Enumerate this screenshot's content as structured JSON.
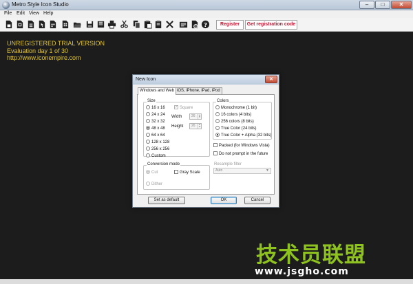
{
  "window": {
    "title": "Metro Style Icon Studio",
    "minimize": "–",
    "maximize": "□",
    "close": "✕"
  },
  "menu": {
    "items": [
      "File",
      "Edit",
      "View",
      "Help"
    ]
  },
  "toolbar": {
    "icons": [
      "new-icon",
      "new-from-image-icon",
      "new-from-file-icon",
      "cursor-icon",
      "template-icon",
      "layout-icon",
      "open-folder-icon",
      "save-icon",
      "save-as-icon",
      "print-icon",
      "cut-icon",
      "copy-icon",
      "paste-icon",
      "delete-icon",
      "import-icon",
      "export-icon",
      "help-icon"
    ],
    "register_label": "Register",
    "get_code_label": "Get registration code"
  },
  "trial": {
    "line1": "UNREGISTERED TRIAL VERSION",
    "line2": "Evaluation day 1 of 30",
    "line3": "http://www.iconempire.com"
  },
  "dialog": {
    "title": "New Icon",
    "close": "✕",
    "tabs": [
      {
        "label": "Windows and Web",
        "active": true
      },
      {
        "label": "iOS, iPhone, iPad, iPod",
        "active": false
      }
    ],
    "size": {
      "label": "Size",
      "options": [
        {
          "label": "16 x 16",
          "checked": false
        },
        {
          "label": "24 x 24",
          "checked": false
        },
        {
          "label": "32 x 32",
          "checked": false
        },
        {
          "label": "48 x 48",
          "checked": true
        },
        {
          "label": "64 x 64",
          "checked": false
        },
        {
          "label": "128 x 128",
          "checked": false
        },
        {
          "label": "256 x 256",
          "checked": false
        },
        {
          "label": "Custom",
          "checked": false
        }
      ],
      "square_label": "Square",
      "width_label": "Width",
      "width_value": "26",
      "height_label": "Height",
      "height_value": "26"
    },
    "colors": {
      "label": "Colors",
      "options": [
        {
          "label": "Monochrome (1 bit)",
          "checked": false
        },
        {
          "label": "16 colors (4 bits)",
          "checked": false
        },
        {
          "label": "256 colors (8 bits)",
          "checked": false
        },
        {
          "label": "True Color (24 bits)",
          "checked": false
        },
        {
          "label": "True Color + Alpha (32 bits)",
          "checked": true
        }
      ]
    },
    "packed_label": "Packed (for Windows Vista)",
    "no_prompt_label": "Do not prompt in the future",
    "resample": {
      "label": "Resample filter",
      "value": "Auto"
    },
    "conversion": {
      "label": "Conversion mode",
      "cut_label": "Cut",
      "dither_label": "Dither",
      "gray_label": "Gray Scale"
    },
    "buttons": {
      "default_label": "Set as default",
      "ok_label": "OK",
      "cancel_label": "Cancel"
    }
  },
  "watermark": {
    "text": "技术员联盟",
    "url": "www.jsgho.com"
  },
  "colors": {
    "trial_text": "#e2c530",
    "register_text": "#c8102e",
    "watermark_green": "#8ec21f",
    "canvas_bg": "#1c1c1c"
  }
}
